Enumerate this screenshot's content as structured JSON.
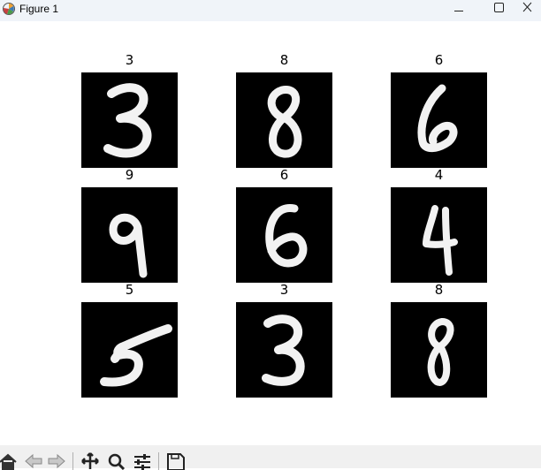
{
  "window": {
    "title": "Figure 1",
    "icons": {
      "app": "matplotlib-icon",
      "minimize": "minimize-icon",
      "maximize": "maximize-icon",
      "close": "close-icon"
    }
  },
  "figure": {
    "image_colormap": "gray",
    "panels": [
      {
        "title": "3"
      },
      {
        "title": "8"
      },
      {
        "title": "6"
      },
      {
        "title": "9"
      },
      {
        "title": "6"
      },
      {
        "title": "4"
      },
      {
        "title": "5"
      },
      {
        "title": "3"
      },
      {
        "title": "8"
      }
    ]
  },
  "toolbar": {
    "buttons": [
      "home-icon",
      "back-arrow-icon",
      "forward-arrow-icon",
      "pan-icon",
      "zoom-icon",
      "configure-subplots-icon",
      "save-icon"
    ]
  }
}
